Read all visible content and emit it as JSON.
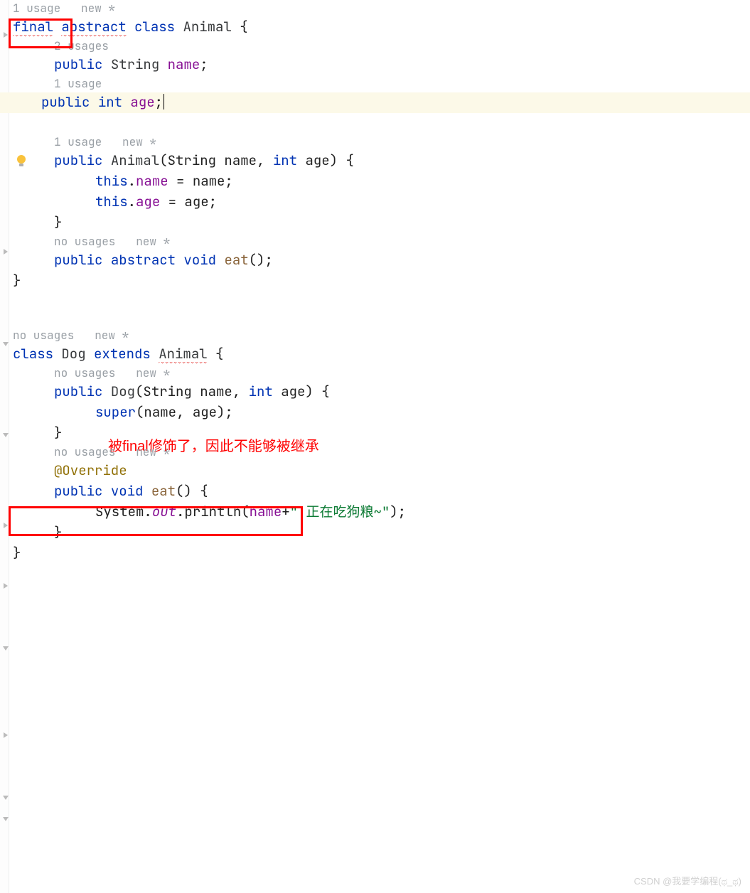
{
  "hints": {
    "u1_new": "1 usage   new *",
    "u2": "2 usages",
    "u1": "1 usage",
    "no_new": "no usages   new *"
  },
  "code": {
    "l1": {
      "a": "final",
      "b": " ",
      "c": "abstract",
      "d": " ",
      "e": "class ",
      "f": "Animal ",
      "g": "{"
    },
    "l2": {
      "a": "public ",
      "b": "String ",
      "c": "name",
      "d": ";"
    },
    "l3": {
      "a": "public ",
      "b": "int ",
      "c": "age",
      "d": ";"
    },
    "l4": {
      "a": "public ",
      "b": "Animal",
      "c": "(String name, ",
      "d": "int ",
      "e": "age) {"
    },
    "l5": {
      "a": "this",
      "b": ".",
      "c": "name ",
      "d": "= name;"
    },
    "l6": {
      "a": "this",
      "b": ".",
      "c": "age ",
      "d": "= age;"
    },
    "l7": {
      "a": "}"
    },
    "l8": {
      "a": "public ",
      "b": "abstract ",
      "c": "void ",
      "d": "eat",
      "e": "();"
    },
    "l9": {
      "a": "}"
    },
    "l10": {
      "a": "class ",
      "b": "Dog ",
      "c": "extends ",
      "d": "Animal",
      "e": " {"
    },
    "l11": {
      "a": "public ",
      "b": "Dog",
      "c": "(String name, ",
      "d": "int ",
      "e": "age) {"
    },
    "l12": {
      "a": "super",
      "b": "(name, age);"
    },
    "l13": {
      "a": "}"
    },
    "l14": {
      "a": "@Override"
    },
    "l15": {
      "a": "public ",
      "b": "void ",
      "c": "eat",
      "d": "() {"
    },
    "l16": {
      "a": "System.",
      "b": "out",
      "c": ".println(",
      "d": "name",
      "e": "+",
      "f": "\" 正在吃狗粮~\"",
      "g": ");"
    },
    "l17": {
      "a": "}"
    },
    "l18": {
      "a": "}"
    }
  },
  "annotation": "被final修饰了，因此不能够被继承",
  "watermark": "CSDN @我要学编程(ಥ_ಥ)"
}
